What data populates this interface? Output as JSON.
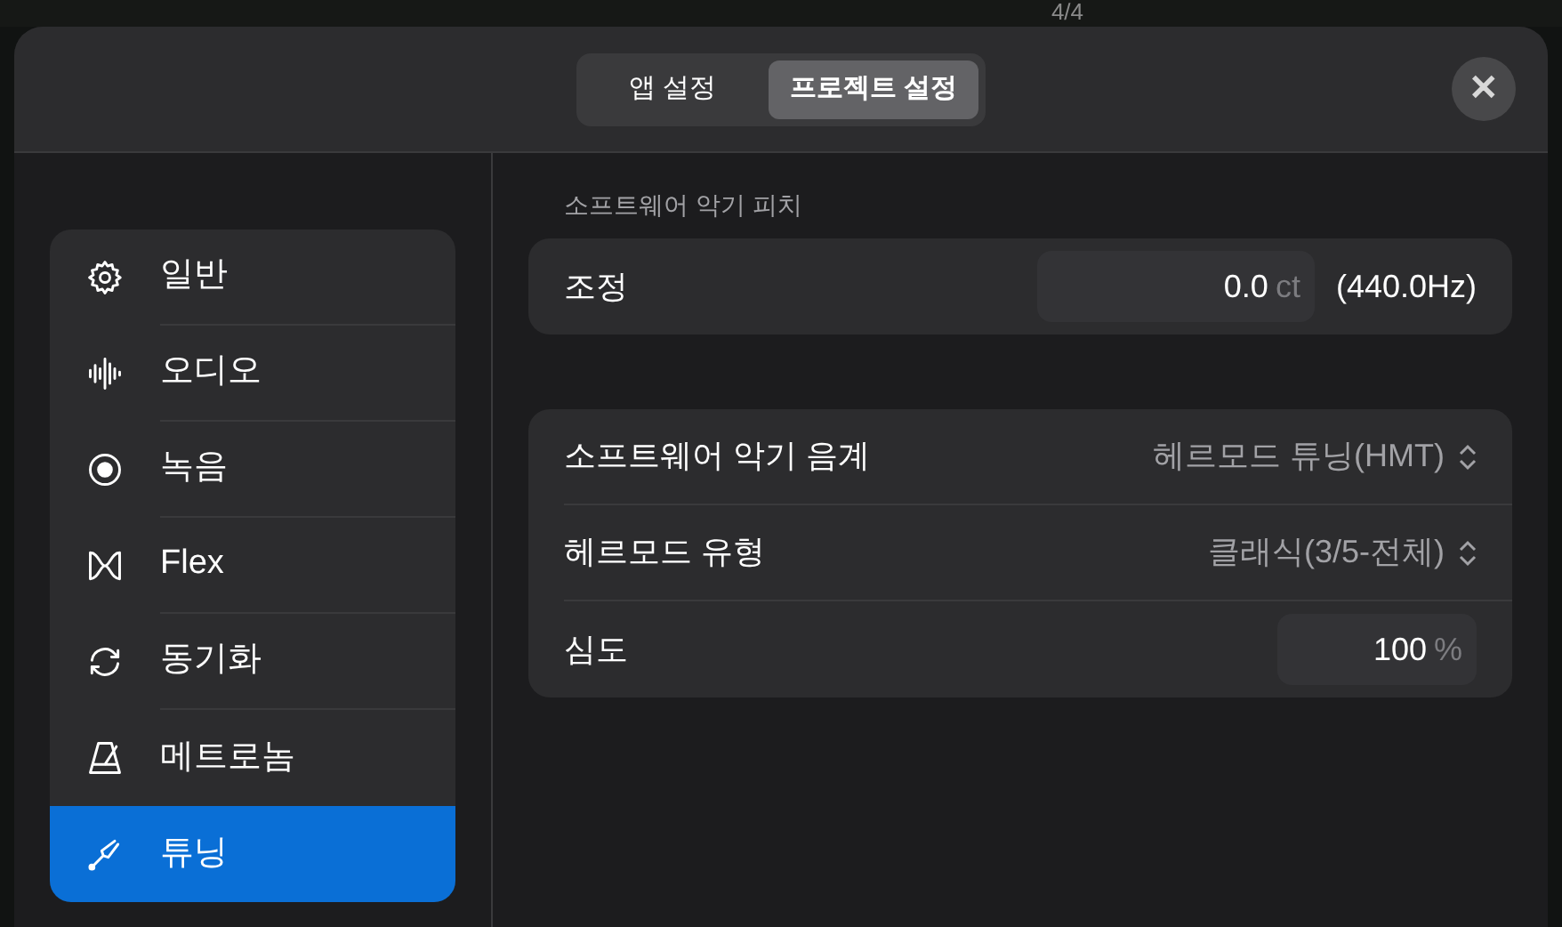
{
  "toolbar": {
    "time_signature": "4/4"
  },
  "segmented": [
    {
      "label": "앱 설정",
      "selected": false
    },
    {
      "label": "프로젝트 설정",
      "selected": true
    }
  ],
  "close_label": "✕",
  "sidebar": {
    "items": [
      {
        "label": "일반",
        "selected": false
      },
      {
        "label": "오디오",
        "selected": false
      },
      {
        "label": "녹음",
        "selected": false
      },
      {
        "label": "Flex",
        "selected": false
      },
      {
        "label": "동기화",
        "selected": false
      },
      {
        "label": "메트로놈",
        "selected": false
      },
      {
        "label": "튜닝",
        "selected": true
      }
    ]
  },
  "sections": [
    {
      "header": "소프트웨어 악기 피치",
      "rows": [
        {
          "kind": "number",
          "label": "조정",
          "value": "0.0",
          "unit": "ct",
          "suffix": "(440.0Hz)"
        }
      ]
    },
    {
      "rows": [
        {
          "kind": "popup",
          "label": "소프트웨어 악기 음계",
          "value": "헤르모드 튜닝(HMT)"
        },
        {
          "kind": "popup",
          "label": "헤르모드 유형",
          "value": "클래식(3/5-전체)"
        },
        {
          "kind": "number",
          "label": "심도",
          "value": "100",
          "unit": "%"
        }
      ]
    }
  ]
}
